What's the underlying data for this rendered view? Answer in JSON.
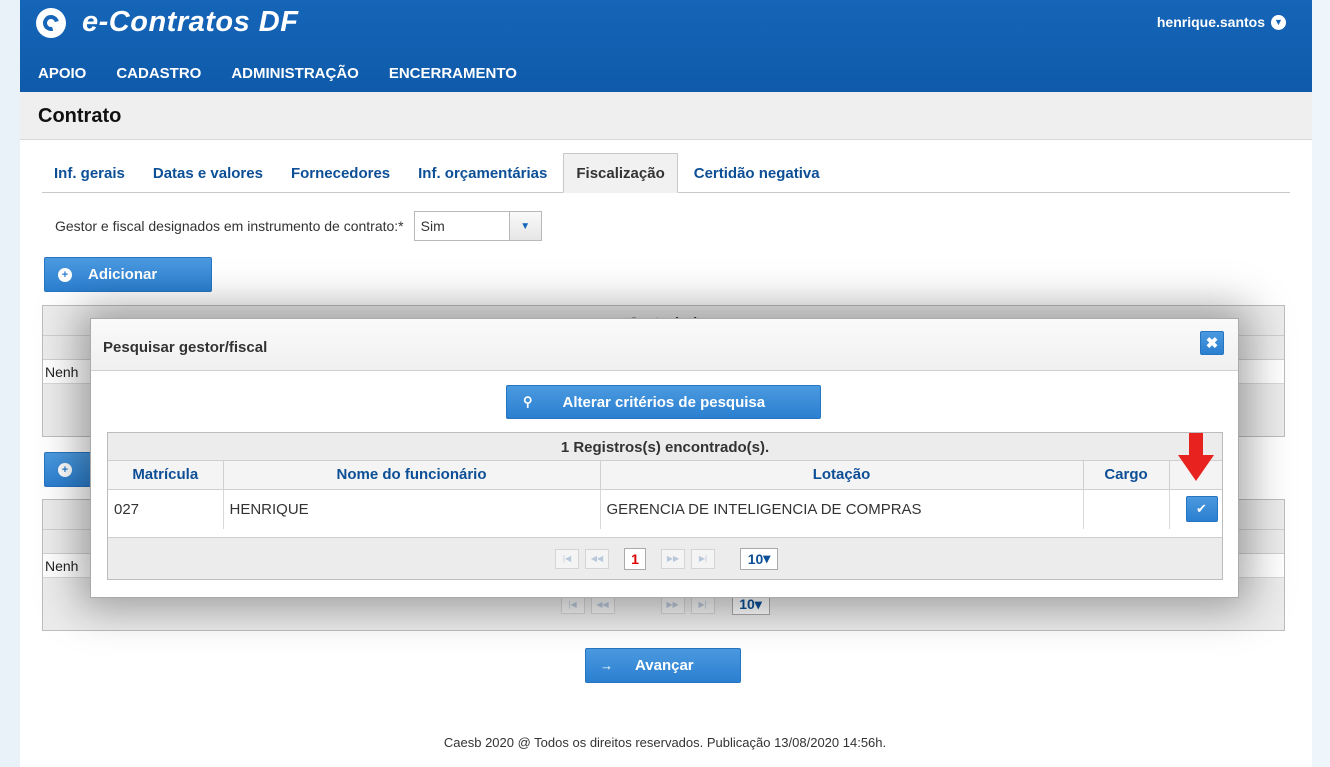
{
  "app": {
    "brand": "e-Contratos DF",
    "user": "henrique.santos"
  },
  "nav": {
    "items": [
      "APOIO",
      "CADASTRO",
      "ADMINISTRAÇÃO",
      "ENCERRAMENTO"
    ]
  },
  "page": {
    "title": "Contrato"
  },
  "tabs": [
    "Inf. gerais",
    "Datas e valores",
    "Fornecedores",
    "Inf. orçamentárias",
    "Fiscalização",
    "Certidão negativa"
  ],
  "active_tab": "Fiscalização",
  "form": {
    "gestor_label": "Gestor e fiscal designados em instrumento de contrato:*",
    "gestor_value": "Sim"
  },
  "buttons": {
    "adicionar": "Adicionar",
    "avancar": "Avançar"
  },
  "background_panels": {
    "panel1_partial_title": "Gestor(es)",
    "empty_text_partial": "Nenh"
  },
  "modal": {
    "title": "Pesquisar gestor/fiscal",
    "search_button": "Alterar critérios de pesquisa",
    "results_header": "1 Registros(s) encontrado(s).",
    "columns": [
      "Matrícula",
      "Nome do funcionário",
      "Lotação",
      "Cargo"
    ],
    "rows": [
      {
        "matricula": "027",
        "nome": "HENRIQUE",
        "lotacao": "GERENCIA DE INTELIGENCIA DE COMPRAS",
        "cargo": ""
      }
    ],
    "pager": {
      "current_page": "1",
      "page_size": "10"
    }
  },
  "footer": {
    "text": "Caesb 2020 @ Todos os direitos reservados. Publicação 13/08/2020 14:56h."
  },
  "icons": {
    "logo": "logo-icon",
    "user_caret": "chevron-down-icon",
    "close": "close-icon",
    "search": "search-icon",
    "check": "check-icon",
    "arrow": "arrow-right-icon",
    "add": "plus-icon"
  },
  "colors": {
    "header_blue": "#1565b8",
    "button_blue": "#2b7fd0",
    "link_blue": "#0d4f96",
    "page_red": "#dd0000",
    "annotation_red": "#e8221e"
  }
}
